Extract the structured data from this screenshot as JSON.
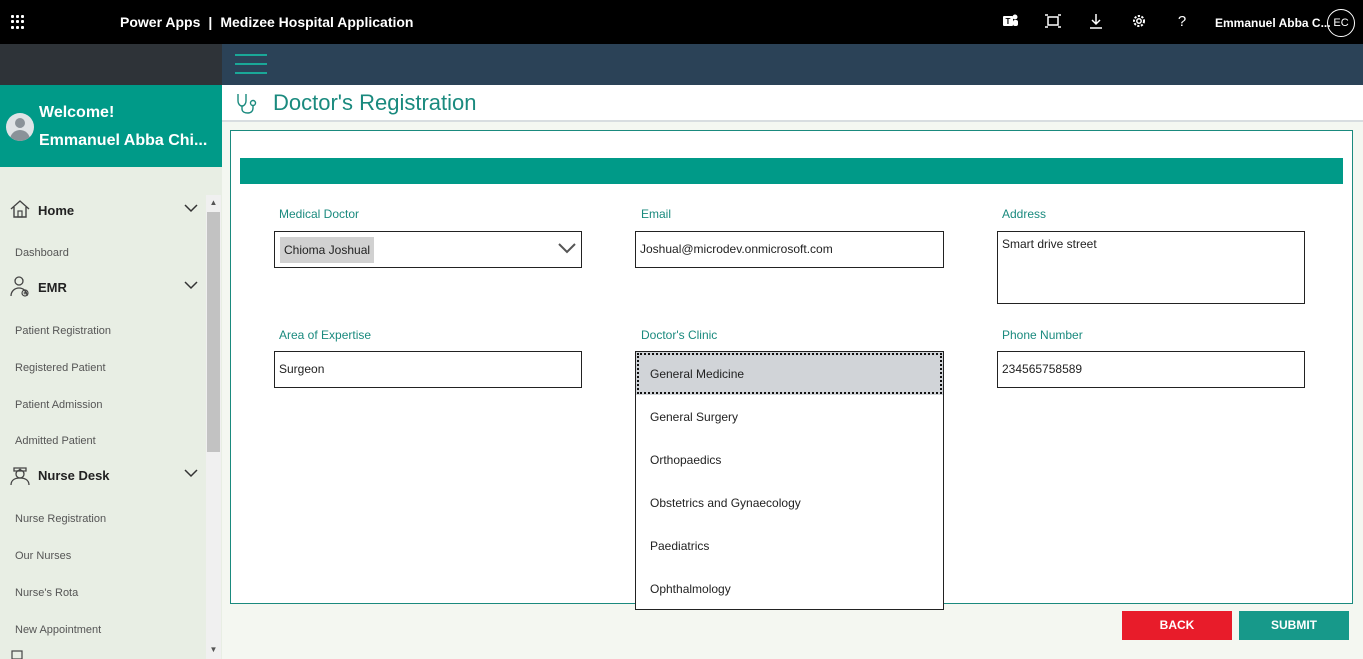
{
  "topbar": {
    "product": "Power Apps",
    "separator": "|",
    "app_name": "Medizee Hospital Application",
    "user_name": "Emmanuel Abba C...",
    "user_initials": "EC",
    "icons": [
      "teams-icon",
      "fit-screen-icon",
      "download-icon",
      "settings-icon",
      "help-icon"
    ],
    "help_glyph": "?"
  },
  "sidebar": {
    "welcome": "Welcome!",
    "user_display": "Emmanuel Abba Chi...",
    "sections": [
      {
        "label": "Home",
        "icon": "home-icon",
        "items": [
          "Dashboard"
        ]
      },
      {
        "label": "EMR",
        "icon": "doctor-icon",
        "items": [
          "Patient Registration",
          "Registered Patient",
          "Patient Admission",
          "Admitted Patient"
        ]
      },
      {
        "label": "Nurse Desk",
        "icon": "nurse-icon",
        "items": [
          "Nurse Registration",
          "Our Nurses",
          "Nurse's Rota",
          "New Appointment"
        ]
      }
    ]
  },
  "page": {
    "title": "Doctor's Registration",
    "icon": "stethoscope-icon"
  },
  "form": {
    "medical_doctor": {
      "label": "Medical Doctor",
      "value": "Chioma Joshual"
    },
    "email": {
      "label": "Email",
      "value": "Joshual@microdev.onmicrosoft.com"
    },
    "address": {
      "label": "Address",
      "value": "Smart drive street"
    },
    "area_of_expertise": {
      "label": "Area of Expertise",
      "value": "Surgeon"
    },
    "doctors_clinic": {
      "label": "Doctor's Clinic",
      "selected": "General Medicine",
      "options": [
        "General Medicine",
        "General Surgery",
        "Orthopaedics",
        "Obstetrics and Gynaecology",
        "Paediatrics",
        "Ophthalmology"
      ]
    },
    "phone_number": {
      "label": "Phone Number",
      "value": "234565758589"
    }
  },
  "buttons": {
    "back": "BACK",
    "submit": "SUBMIT"
  },
  "colors": {
    "accent": "#009a88",
    "title_teal": "#1a8a7e",
    "back_red": "#e81c2a",
    "submit_teal": "#17998a",
    "header_navy": "#2b4257"
  }
}
